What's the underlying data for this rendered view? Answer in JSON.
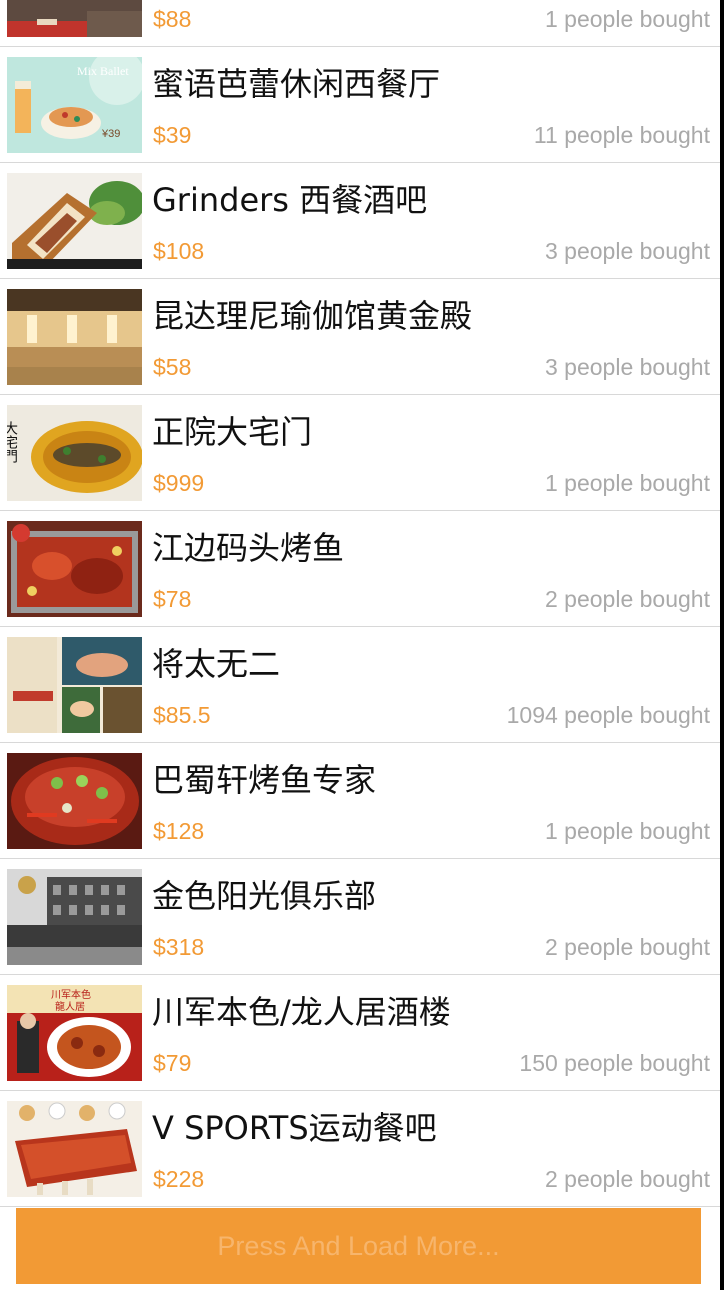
{
  "deals": [
    {
      "title": "",
      "price": "$88",
      "bought": "1 people bought",
      "image": "restaurant-photo"
    },
    {
      "title": "蜜语芭蕾休闲西餐厅",
      "price": "$39",
      "bought": "11 people bought",
      "image": "mix-ballet-dessert-poster",
      "image_text": [
        "Mix Ballet",
        "¥39"
      ]
    },
    {
      "title": "Grinders 西餐酒吧",
      "price": "$108",
      "bought": "3 people bought",
      "image": "sandwich-photo"
    },
    {
      "title": "昆达理尼瑜伽馆黄金殿",
      "price": "$58",
      "bought": "3 people bought",
      "image": "yoga-hall-photo"
    },
    {
      "title": "正院大宅门",
      "price": "$999",
      "bought": "1 people bought",
      "image": "braised-fish-photo",
      "image_text": [
        "大宅門"
      ]
    },
    {
      "title": "江边码头烤鱼",
      "price": "$78",
      "bought": "2 people bought",
      "image": "grilled-fish-tray-photo"
    },
    {
      "title": "将太无二",
      "price": "$85.5",
      "bought": "1094 people bought",
      "image": "sushi-collage-photo"
    },
    {
      "title": "巴蜀轩烤鱼专家",
      "price": "$128",
      "bought": "1 people bought",
      "image": "spicy-fish-photo"
    },
    {
      "title": "金色阳光俱乐部",
      "price": "$318",
      "bought": "2 people bought",
      "image": "club-building-photo"
    },
    {
      "title": "川军本色/龙人居酒楼",
      "price": "$79",
      "bought": "150 people bought",
      "image": "chuanjun-poster",
      "image_text": [
        "川军本色",
        "龍人居"
      ]
    },
    {
      "title": "V SPORTS运动餐吧",
      "price": "$228",
      "bought": "2 people bought",
      "image": "ribs-photo"
    }
  ],
  "load_more": {
    "label": "Press And Load More..."
  },
  "colors": {
    "price": "#f29a35",
    "bought": "#a9a9a9",
    "button": "#f29a35",
    "button_text": "#f7b56c"
  }
}
